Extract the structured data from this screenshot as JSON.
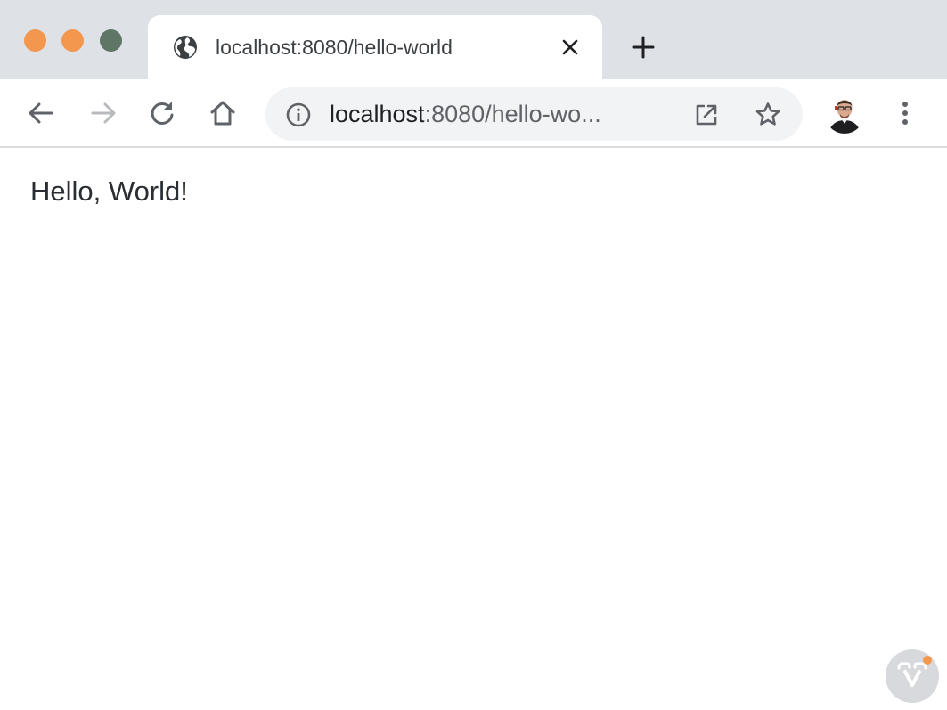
{
  "window": {
    "traffic_lights": {
      "close_color": "#f3974e",
      "minimize_color": "#f3974e",
      "maximize_color": "#5f7565"
    }
  },
  "tab": {
    "title": "localhost:8080/hello-world",
    "favicon": "globe-icon",
    "close_icon": "close-icon"
  },
  "new_tab": {
    "icon": "plus-icon"
  },
  "toolbar": {
    "back_icon": "arrow-left-icon",
    "forward_icon": "arrow-right-icon",
    "forward_disabled": true,
    "reload_icon": "reload-icon",
    "home_icon": "home-icon",
    "address": {
      "info_icon": "info-icon",
      "host": "localhost",
      "rest": ":8080/hello-wo...",
      "open_icon": "open-external-icon",
      "bookmark_icon": "star-icon"
    },
    "profile_icon": "avatar",
    "menu_icon": "more-vert-icon"
  },
  "page": {
    "text": "Hello, World!"
  },
  "badge": {
    "icon": "vaadin-logo-icon",
    "dot_color": "#f3974e"
  },
  "colors": {
    "tabstrip_bg": "#dee1e6",
    "omnibox_bg": "#f1f3f4",
    "icon_color": "#5f6368",
    "text_color": "#2a2e33"
  }
}
